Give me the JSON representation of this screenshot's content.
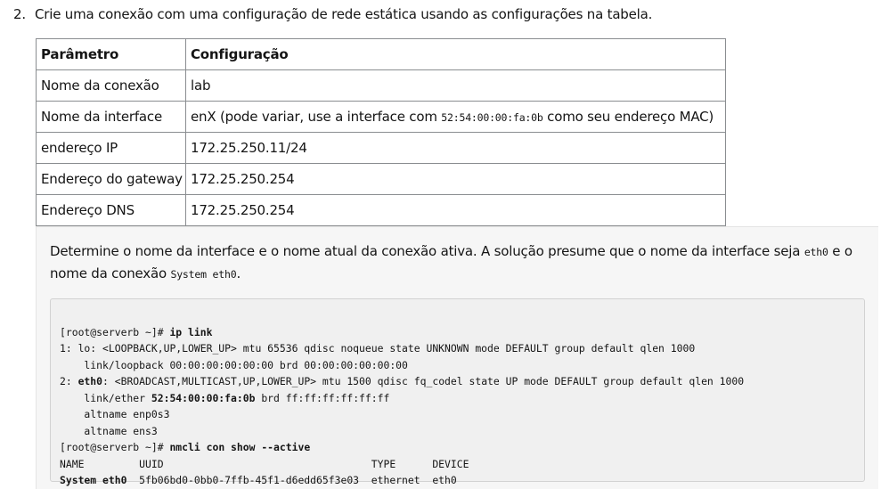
{
  "step": {
    "number": "2.",
    "text": "Crie uma conexão com uma configuração de rede estática usando as configurações na tabela."
  },
  "table": {
    "headers": [
      "Parâmetro",
      "Configuração"
    ],
    "rows": [
      {
        "param": "Nome da conexão",
        "value": "lab"
      },
      {
        "param": "Nome da interface",
        "value_prefix": "enX (pode variar, use a interface com ",
        "value_code": "52:54:00:00:fa:0b",
        "value_suffix": " como seu endereço MAC)"
      },
      {
        "param": "endereço IP",
        "value": "172.25.250.11/24"
      },
      {
        "param": "Endereço do gateway",
        "value": "172.25.250.254"
      },
      {
        "param": "Endereço DNS",
        "value": "172.25.250.254"
      }
    ]
  },
  "solution": {
    "intro_1": "Determine o nome da interface e o nome atual da conexão ativa. A solução presume que o nome da interface seja ",
    "intro_code_1": "eth0",
    "intro_2": " e o nome da conexão ",
    "intro_code_2": "System eth0",
    "intro_3": ".",
    "terminal": {
      "l1_prompt": "[root@serverb ~]# ",
      "l1_cmd": "ip link",
      "l2": "1: lo: <LOOPBACK,UP,LOWER_UP> mtu 65536 qdisc noqueue state UNKNOWN mode DEFAULT group default qlen 1000",
      "l3": "    link/loopback 00:00:00:00:00:00 brd 00:00:00:00:00:00",
      "l4_pre": "2: ",
      "l4_bold": "eth0",
      "l4_post": ": <BROADCAST,MULTICAST,UP,LOWER_UP> mtu 1500 qdisc fq_codel state UP mode DEFAULT group default qlen 1000",
      "l5_pre": "    link/ether ",
      "l5_bold": "52:54:00:00:fa:0b",
      "l5_post": " brd ff:ff:ff:ff:ff:ff",
      "l6": "    altname enp0s3",
      "l7": "    altname ens3",
      "l8_prompt": "[root@serverb ~]# ",
      "l8_cmd": "nmcli con show --active",
      "l9": "NAME         UUID                                  TYPE      DEVICE",
      "l10_bold": "System eth0",
      "l10_post": "  5fb06bd0-0bb0-7ffb-45f1-d6edd65f3e03  ethernet  eth0"
    }
  }
}
